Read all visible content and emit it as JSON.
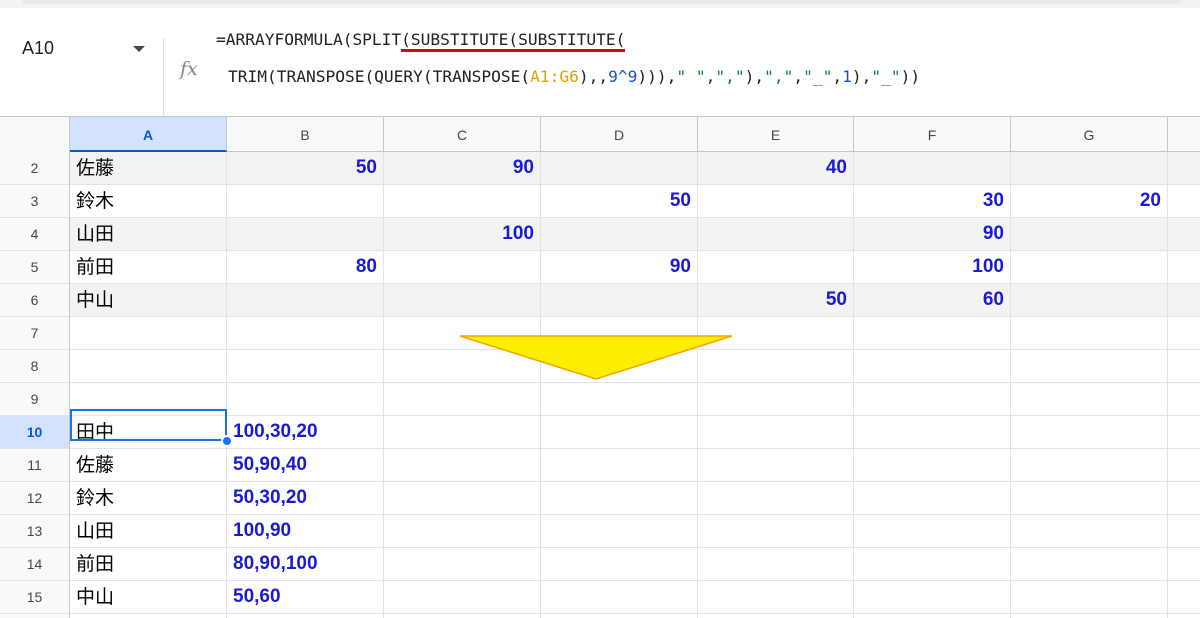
{
  "name_box": {
    "value": "A10"
  },
  "formula_bar": {
    "fx_label": "fx",
    "line1": {
      "prefix": "=ARRAYFORMULA(SPLIT",
      "underlined": "(SUBSTITUTE(SUBSTITUTE("
    },
    "line2": {
      "t1": "TRIM(TRANSPOSE(QUERY(TRANSPOSE(",
      "range": "A1:G6",
      "t2": "),,",
      "num1": "9^9",
      "t3": "))),",
      "s1": "\" \"",
      "t4": ",",
      "s2": "\",\"",
      "t5": "),",
      "s3": "\",\"",
      "t6": ",",
      "s4": "\"_\"",
      "t7": ",",
      "num2": "1",
      "t8": "),",
      "s5": "\"_\"",
      "t9": "))"
    }
  },
  "columns": [
    "A",
    "B",
    "C",
    "D",
    "E",
    "F",
    "G"
  ],
  "rows": [
    {
      "num": "2",
      "name": "佐藤",
      "B": "50",
      "C": "90",
      "D": "",
      "E": "40",
      "F": "",
      "G": ""
    },
    {
      "num": "3",
      "name": "鈴木",
      "B": "",
      "C": "",
      "D": "50",
      "E": "",
      "F": "30",
      "G": "20"
    },
    {
      "num": "4",
      "name": "山田",
      "B": "",
      "C": "100",
      "D": "",
      "E": "",
      "F": "90",
      "G": ""
    },
    {
      "num": "5",
      "name": "前田",
      "B": "80",
      "C": "",
      "D": "90",
      "E": "",
      "F": "100",
      "G": ""
    },
    {
      "num": "6",
      "name": "中山",
      "B": "",
      "C": "",
      "D": "",
      "E": "50",
      "F": "60",
      "G": ""
    },
    {
      "num": "7",
      "name": "",
      "result": ""
    },
    {
      "num": "8",
      "name": "",
      "result": ""
    },
    {
      "num": "9",
      "name": "",
      "result": ""
    },
    {
      "num": "10",
      "name": "田中",
      "result": "100,30,20"
    },
    {
      "num": "11",
      "name": "佐藤",
      "result": "50,90,40"
    },
    {
      "num": "12",
      "name": "鈴木",
      "result": "50,30,20"
    },
    {
      "num": "13",
      "name": "山田",
      "result": "100,90"
    },
    {
      "num": "14",
      "name": "前田",
      "result": "80,90,100"
    },
    {
      "num": "15",
      "name": "中山",
      "result": "50,60"
    }
  ],
  "active_cell": "A10",
  "colors": {
    "value_text": "#1a1ad6",
    "selection": "#1a73e8",
    "arrow_fill": "#ffee00",
    "arrow_stroke": "#f5a300",
    "underline": "#e10000"
  }
}
